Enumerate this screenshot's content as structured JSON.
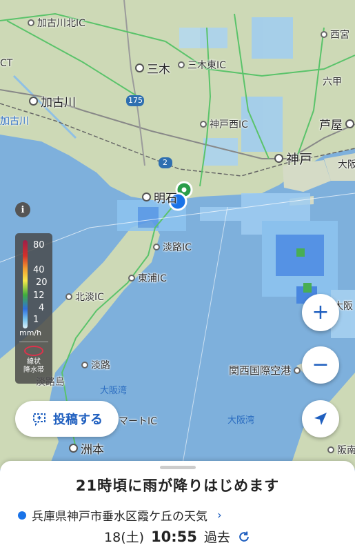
{
  "map": {
    "places": {
      "kakogawa_kita_ic": "加古川北IC",
      "nishiyo": "西宮",
      "ct": "CT",
      "miki": "三木",
      "miki_higashi_ic": "三木東IC",
      "rokko": "六甲",
      "kakogawa": "加古川",
      "route_175": "175",
      "kobe_nishi_ic": "神戸西IC",
      "ashiya": "芦屋",
      "kakogawa_river": "加古川",
      "route_2": "2",
      "kobe": "神戸",
      "osaka": "大阪",
      "akashi": "明石",
      "awaji_ic": "淡路IC",
      "higashiura_ic": "東浦IC",
      "hokudan_ic": "北淡IC",
      "osaka_east": "大阪",
      "kansai_airport": "関西国際空港",
      "awaji": "淡路",
      "awajishima": "淡路島",
      "osaka_bay_1": "大阪湾",
      "osaka_bay_2": "大阪湾",
      "mart_ic": "マートIC",
      "sumoto": "洲本",
      "hannan": "阪南"
    }
  },
  "legend": {
    "values": [
      "80",
      "40",
      "20",
      "12",
      "4",
      "1"
    ],
    "unit": "mm/h",
    "band_label_1": "線状",
    "band_label_2": "降水帯"
  },
  "post_button": {
    "label": "投稿する"
  },
  "zoom": {
    "in": "+",
    "out": "−"
  },
  "sheet": {
    "forecast": "21時頃に雨が降りはじめます",
    "location": "兵庫県神戸市垂水区霞ケ丘の天気",
    "date": "18(土)",
    "time": "10:55",
    "mode": "過去"
  },
  "colors": {
    "accent": "#1f5fbf",
    "location_blue": "#1a73e8",
    "pin_green": "#2a9d4a"
  }
}
